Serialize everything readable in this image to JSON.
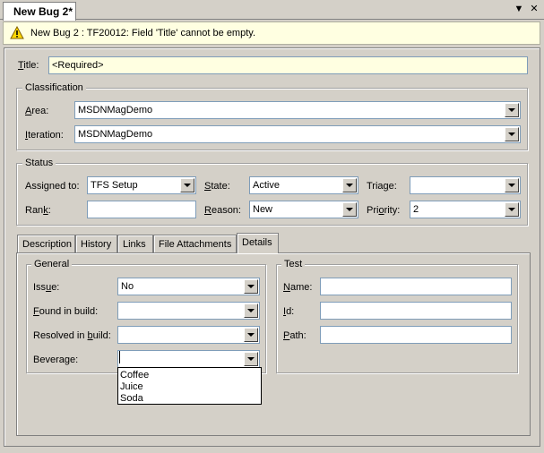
{
  "window": {
    "tab_title": "New Bug 2*",
    "pin_glyph": "▼",
    "close_glyph": "✕"
  },
  "infobar": {
    "icon": "warning-icon",
    "message": "New Bug 2 : TF20012: Field 'Title' cannot be empty."
  },
  "title_field": {
    "label_ul": "T",
    "label_rest": "itle:",
    "value": "<Required>"
  },
  "classification": {
    "legend": "Classification",
    "area": {
      "label_ul": "A",
      "label_rest": "rea:",
      "value": "MSDNMagDemo"
    },
    "iteration": {
      "label_ul": "I",
      "label_rest": "teration:",
      "value": "MSDNMagDemo"
    }
  },
  "status": {
    "legend": "Status",
    "assigned_to": {
      "label": "Assigned to:",
      "value": "TFS Setup"
    },
    "state": {
      "label_ul": "S",
      "label_rest": "tate:",
      "value": "Active"
    },
    "triage": {
      "label_pre": "Tria",
      "label_ul": "g",
      "label_rest": "e:",
      "value": ""
    },
    "rank": {
      "label_pre": "Ran",
      "label_ul": "k",
      "label_rest": ":",
      "value": ""
    },
    "reason": {
      "label_ul": "R",
      "label_rest": "eason:",
      "value": "New"
    },
    "priority": {
      "label_pre": "Pri",
      "label_ul": "o",
      "label_rest": "rity:",
      "value": "2"
    }
  },
  "tabs": [
    {
      "label": "Description"
    },
    {
      "label": "History"
    },
    {
      "label": "Links"
    },
    {
      "label": "File Attachments"
    },
    {
      "label": "Details"
    }
  ],
  "active_tab": "Details",
  "general": {
    "legend": "General",
    "issue": {
      "label_pre": "Iss",
      "label_ul": "u",
      "label_rest": "e:",
      "value": "No"
    },
    "found_in_build": {
      "label_ul": "F",
      "label_rest": "ound in build:",
      "value": ""
    },
    "resolved_in_build": {
      "label_pre": "Resolved in ",
      "label_ul": "b",
      "label_rest": "uild:",
      "value": ""
    },
    "beverage": {
      "label": "Beverage:",
      "value": "",
      "options": [
        "Coffee",
        "Juice",
        "Soda"
      ]
    }
  },
  "test": {
    "legend": "Test",
    "name": {
      "label_ul": "N",
      "label_rest": "ame:",
      "value": ""
    },
    "id": {
      "label_ul": "I",
      "label_rest": "d:",
      "value": ""
    },
    "path": {
      "label_ul": "P",
      "label_rest": "ath:",
      "value": ""
    }
  },
  "colors": {
    "infobar_bg": "#ffffe1",
    "required_bg": "#ffffe1",
    "chrome": "#d4d0c8",
    "input_border": "#7f9db9"
  }
}
